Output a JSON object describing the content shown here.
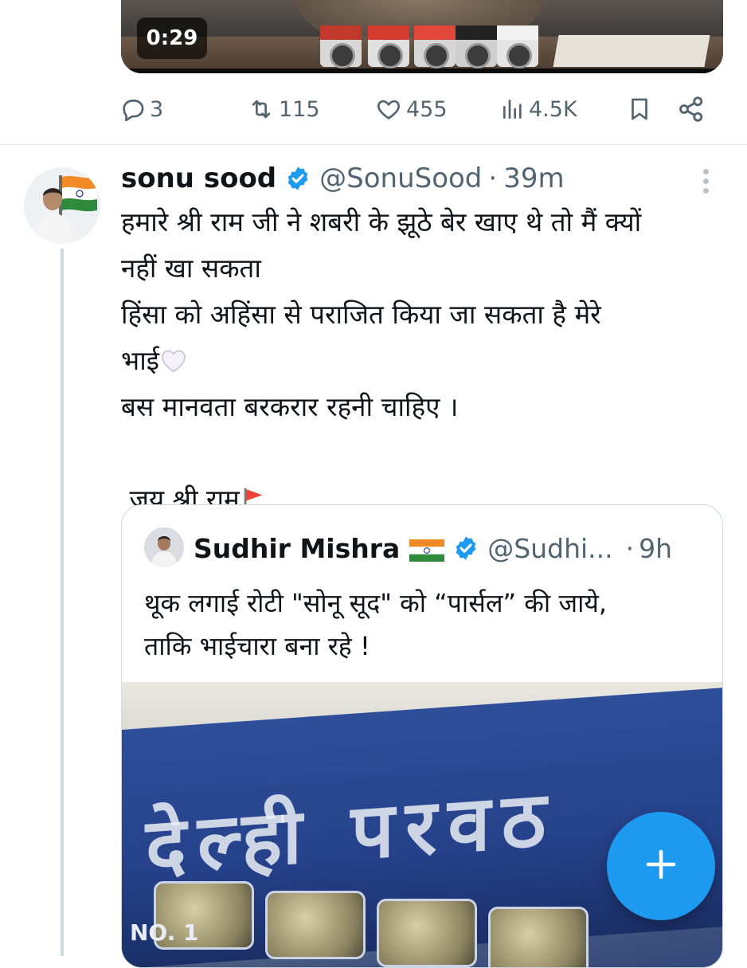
{
  "previous_tweet": {
    "video": {
      "duration": "0:29"
    },
    "actions": {
      "replies": "3",
      "retweets": "115",
      "likes": "455",
      "views": "4.5K"
    }
  },
  "tweet": {
    "author_name": "sonu sood",
    "author_handle": "@SonuSood",
    "separator": "·",
    "time": "39m",
    "lines": [
      "हमारे श्री राम जी ने शबरी के झूठे बेर खाए थे तो मैं क्यों",
      "नहीं खा सकता",
      "हिंसा को अहिंसा से पराजित किया जा सकता है मेरे",
      "भाई",
      "बस मानवता बरकरार रहनी चाहिए ।",
      " जय श्री राम"
    ],
    "emoji": {
      "after_line_4": "white-heart",
      "after_line_6": "triangular-flag"
    }
  },
  "quoted_tweet": {
    "author_name": "Sudhir Mishra",
    "author_handle": "@Sudhi...",
    "separator": "·",
    "time": "9h",
    "lines": [
      "थूक लगाई रोटी \"सोनू सूद\" को “पार्सल” की जाये,",
      "ताकि भाईचारा बना रहे !"
    ],
    "media_sign_text": "देल्ही परवठ",
    "media_label": "NO. 1"
  },
  "colors": {
    "accent": "#1d9bf0",
    "muted": "#536471",
    "text": "#0f1419",
    "border": "#cfd9de"
  },
  "icons": {
    "reply": "reply-icon",
    "retweet": "retweet-icon",
    "like": "heart-icon",
    "views": "views-icon",
    "bookmark": "bookmark-icon",
    "share": "share-icon",
    "verified": "verified-badge-icon",
    "more": "more-options-icon",
    "compose": "plus-icon"
  }
}
